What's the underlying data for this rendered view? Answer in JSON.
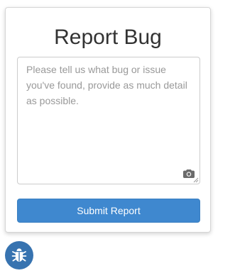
{
  "form": {
    "title": "Report Bug",
    "textarea_value": "",
    "textarea_placeholder": "Please tell us what bug or issue you've found, provide as much detail as possible.",
    "submit_label": "Submit Report",
    "attach_icon": "camera-icon"
  },
  "fab": {
    "icon": "bug-icon"
  },
  "colors": {
    "primary_button": "#3f88cf",
    "fab_background": "#3773b0",
    "title_text": "#333333",
    "placeholder_text": "#999999"
  }
}
